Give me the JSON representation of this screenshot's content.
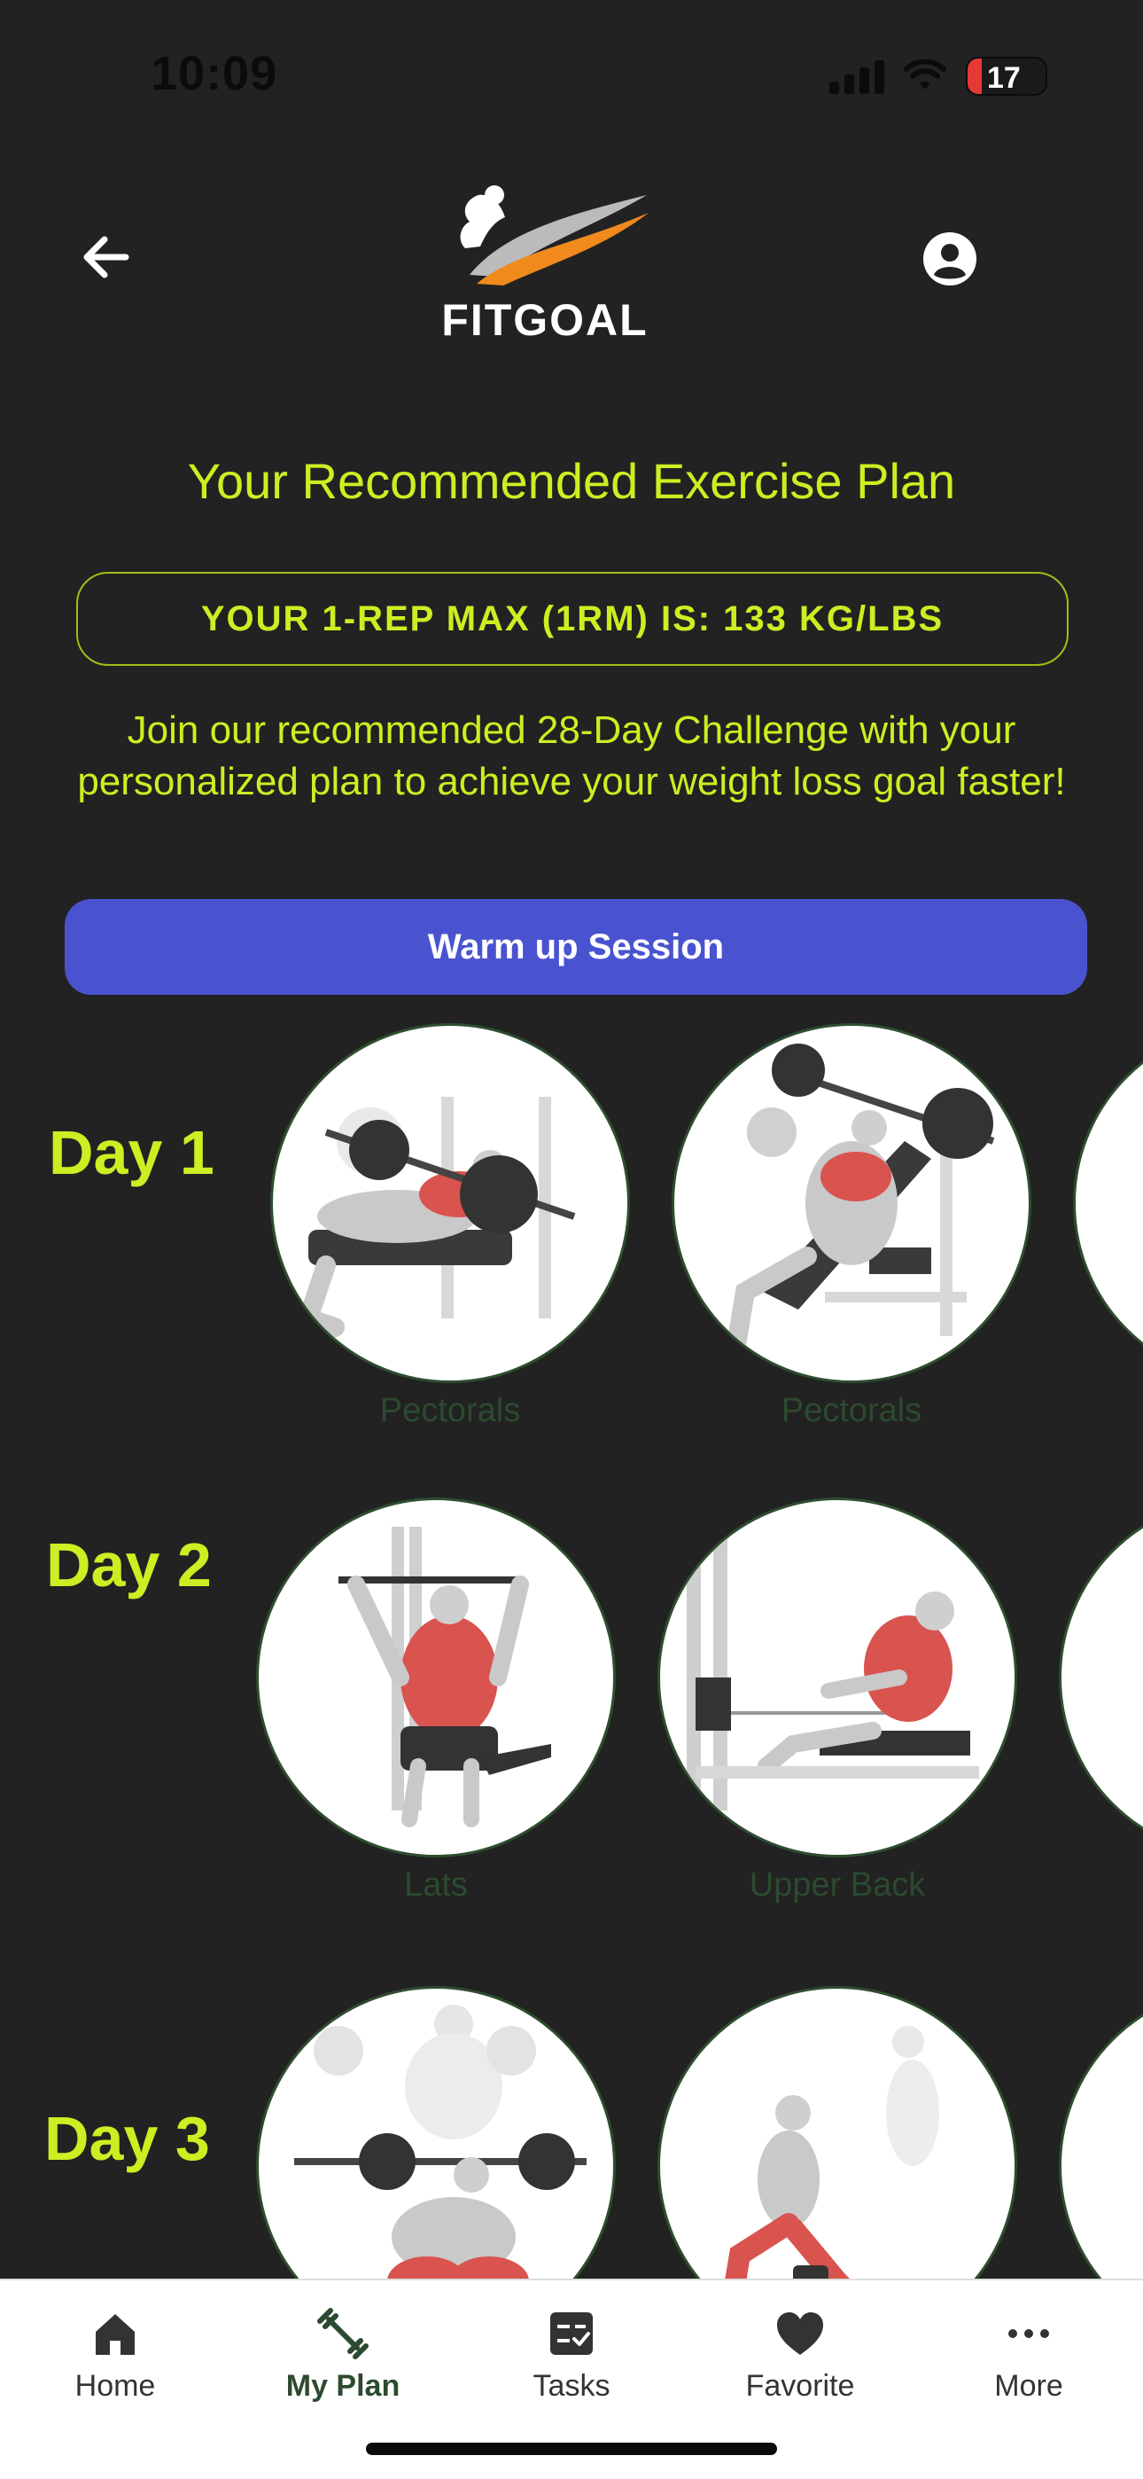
{
  "status_bar": {
    "time": "10:09",
    "battery": "17"
  },
  "header": {
    "brand": "FITGOAL"
  },
  "plan": {
    "title": "Your Recommended Exercise Plan",
    "rm_label": "YOUR 1-REP MAX (1RM) IS: 133 KG/LBS",
    "challenge_text": "Join our recommended 28-Day Challenge with your personalized plan to achieve your weight loss goal faster!",
    "warmup_label": "Warm up Session"
  },
  "days": [
    {
      "label": "Day 1",
      "exercises": [
        {
          "muscle": "Pectorals"
        },
        {
          "muscle": "Pectorals"
        }
      ]
    },
    {
      "label": "Day 2",
      "exercises": [
        {
          "muscle": "Lats"
        },
        {
          "muscle": "Upper Back"
        }
      ]
    },
    {
      "label": "Day 3",
      "exercises": [
        {
          "muscle": ""
        },
        {
          "muscle": ""
        }
      ]
    }
  ],
  "nav": {
    "items": [
      {
        "label": "Home",
        "icon": "home-icon",
        "active": false
      },
      {
        "label": "My Plan",
        "icon": "dumbbell-icon",
        "active": true
      },
      {
        "label": "Tasks",
        "icon": "tasks-icon",
        "active": false
      },
      {
        "label": "Favorite",
        "icon": "heart-icon",
        "active": false
      },
      {
        "label": "More",
        "icon": "more-icon",
        "active": false
      }
    ]
  },
  "colors": {
    "background": "#222222",
    "accent": "#ccee22",
    "button": "#4a53cf",
    "muscle_label": "#2c4a2f",
    "muscle_highlight": "#d9534f"
  }
}
